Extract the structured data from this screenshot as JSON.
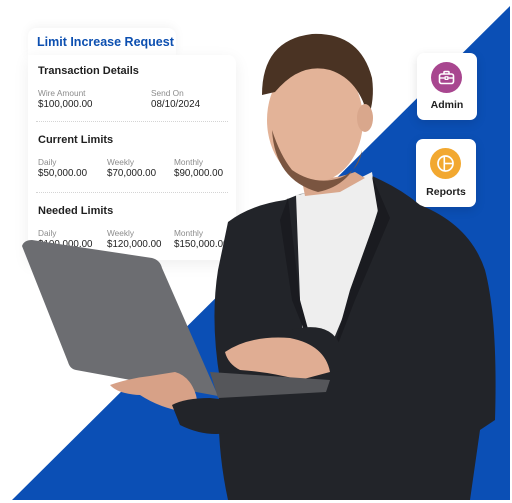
{
  "colors": {
    "brand_blue": "#0b4fb5",
    "title_blue": "#0c4fb0",
    "admin_icon_bg": "#a8468f",
    "reports_icon_bg": "#f2a830",
    "card_bg": "#ffffff",
    "label_gray": "#8c8c8c",
    "value_dark": "#222222"
  },
  "request_card": {
    "title": "Limit Increase Request",
    "transaction_details": {
      "heading": "Transaction Details",
      "fields": [
        {
          "label": "Wire Amount",
          "value": "$100,000.00"
        },
        {
          "label": "Send On",
          "value": "08/10/2024"
        }
      ]
    },
    "current_limits": {
      "heading": "Current Limits",
      "fields": [
        {
          "label": "Daily",
          "value": "$50,000.00"
        },
        {
          "label": "Weekly",
          "value": "$70,000.00"
        },
        {
          "label": "Monthly",
          "value": "$90,000.00"
        }
      ]
    },
    "needed_limits": {
      "heading": "Needed Limits",
      "fields": [
        {
          "label": "Daily",
          "value": "$100,000.00"
        },
        {
          "label": "Weekly",
          "value": "$120,000.00"
        },
        {
          "label": "Monthly",
          "value": "$150,000.00"
        }
      ]
    }
  },
  "tiles": [
    {
      "label": "Admin",
      "icon": "briefcase-icon"
    },
    {
      "label": "Reports",
      "icon": "pie-chart-icon"
    }
  ],
  "photo": {
    "subject": "man in dark suit typing on laptop"
  }
}
